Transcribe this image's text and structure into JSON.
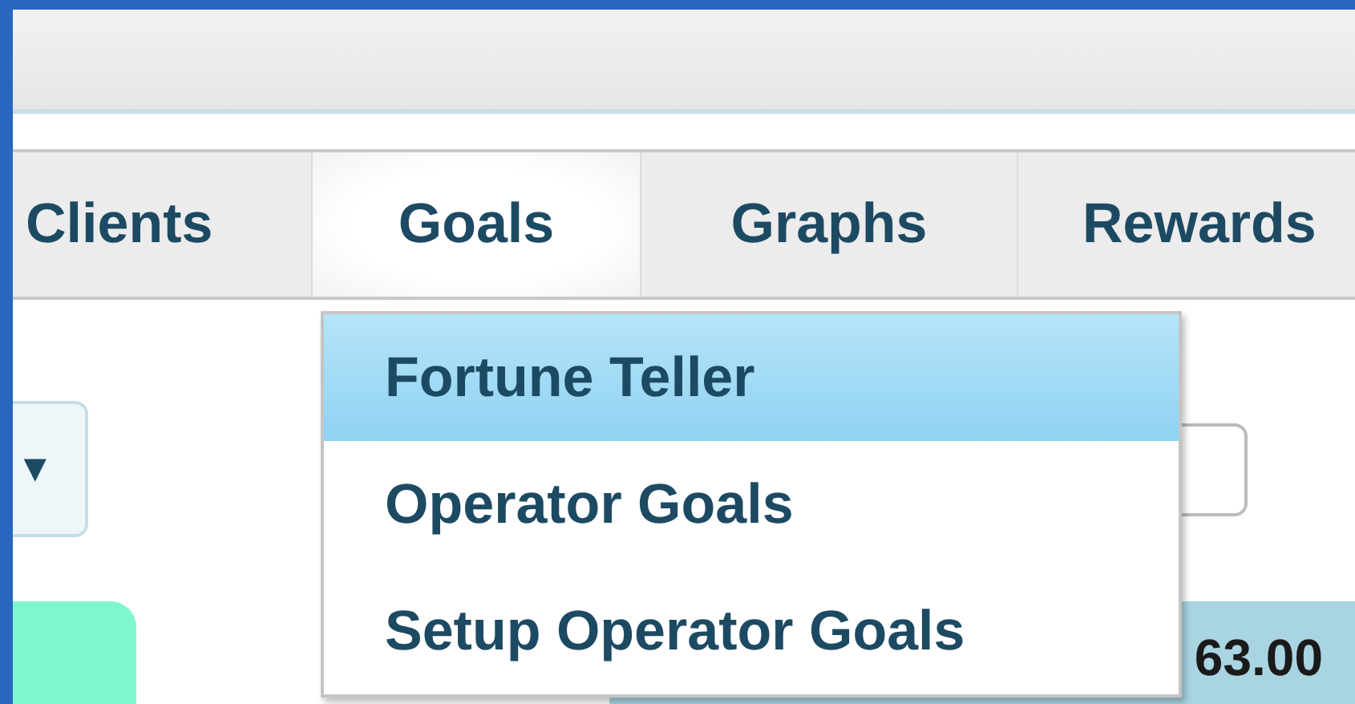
{
  "tabs": [
    {
      "label": "Clients",
      "selected": false
    },
    {
      "label": "Goals",
      "selected": true
    },
    {
      "label": "Graphs",
      "selected": false
    },
    {
      "label": "Rewards",
      "selected": false
    }
  ],
  "menu": {
    "items": [
      {
        "label": "Fortune Teller",
        "selected": true
      },
      {
        "label": "Operator Goals",
        "selected": false
      },
      {
        "label": "Setup Operator Goals",
        "selected": false
      }
    ]
  },
  "filter": {
    "caret": "▼"
  },
  "summary": {
    "value": "63.00"
  }
}
